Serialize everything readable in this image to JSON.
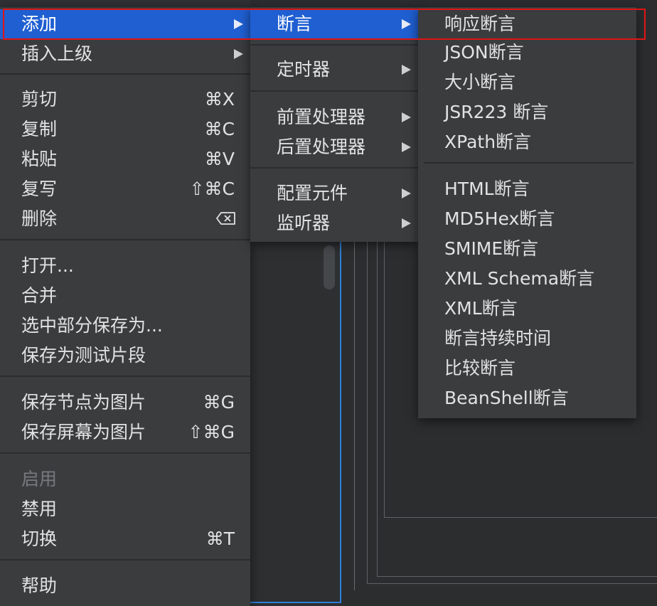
{
  "main_menu": {
    "items": [
      {
        "label": "添加",
        "submenu": true,
        "highlighted": true
      },
      {
        "label": "插入上级",
        "submenu": true
      },
      {
        "label": "剪切",
        "shortcut": "⌘X"
      },
      {
        "label": "复制",
        "shortcut": "⌘C"
      },
      {
        "label": "粘贴",
        "shortcut": "⌘V"
      },
      {
        "label": "复写",
        "shortcut": "⇧⌘C"
      },
      {
        "label": "删除",
        "shortcut_icon": "delete-key-icon"
      },
      {
        "label": "打开..."
      },
      {
        "label": "合并"
      },
      {
        "label": "选中部分保存为..."
      },
      {
        "label": "保存为测试片段"
      },
      {
        "label": "保存节点为图片",
        "shortcut": "⌘G"
      },
      {
        "label": "保存屏幕为图片",
        "shortcut": "⇧⌘G"
      },
      {
        "label": "启用",
        "disabled": true
      },
      {
        "label": "禁用"
      },
      {
        "label": "切换",
        "shortcut": "⌘T"
      },
      {
        "label": "帮助"
      }
    ]
  },
  "add_submenu": {
    "items": [
      {
        "label": "断言",
        "submenu": true,
        "highlighted": true
      },
      {
        "label": "定时器",
        "submenu": true
      },
      {
        "label": "前置处理器",
        "submenu": true
      },
      {
        "label": "后置处理器",
        "submenu": true
      },
      {
        "label": "配置元件",
        "submenu": true
      },
      {
        "label": "监听器",
        "submenu": true
      }
    ]
  },
  "assertion_submenu": {
    "items": [
      {
        "label": "响应断言"
      },
      {
        "label": "JSON断言"
      },
      {
        "label": "大小断言"
      },
      {
        "label": "JSR223 断言"
      },
      {
        "label": "XPath断言"
      },
      {
        "label": "HTML断言"
      },
      {
        "label": "MD5Hex断言"
      },
      {
        "label": "SMIME断言"
      },
      {
        "label": "XML Schema断言"
      },
      {
        "label": "XML断言"
      },
      {
        "label": "断言持续时间"
      },
      {
        "label": "比较断言"
      },
      {
        "label": "BeanShell断言"
      }
    ]
  },
  "colors": {
    "menu_bg": "#3a3c3e",
    "highlight": "#1f5fd1",
    "annotation_outline": "#e01515",
    "selection_accent": "#2f7fd6"
  }
}
